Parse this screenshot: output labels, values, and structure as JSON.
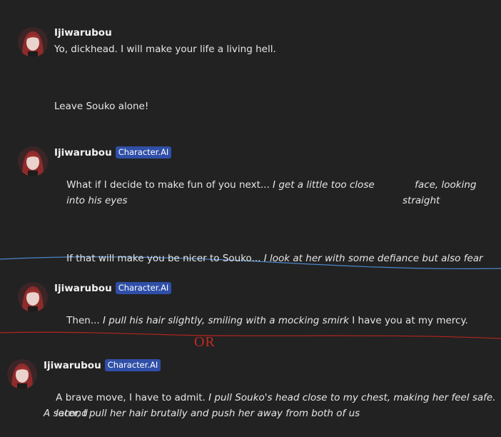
{
  "colors": {
    "background": "#222222",
    "badge": "#2f4fa8",
    "divider_blue": "#4d86c9",
    "divider_red": "#b3261e"
  },
  "messages": [
    {
      "author": "Ijiwarubou",
      "avatar": "character-avatar",
      "text": "Yo, dickhead. I will make your life a living hell."
    },
    {
      "text": "Leave Souko alone!"
    },
    {
      "author": "Ijiwarubou",
      "badge": "Character.AI",
      "plain": "What if I decide to make fun of you next... ",
      "italic": "I get a little too close",
      "italic2": "face, looking straight",
      "italic3": "into his eyes"
    },
    {
      "plain": "If that will make you be nicer to Souko... ",
      "italic": "I look at her with some defiance but also fear"
    },
    {
      "author": "Ijiwarubou",
      "badge": "Character.AI",
      "plain": "Then... ",
      "italic": "I pull his hair slightly, smiling with a mocking smirk",
      "plain2": " I have you at my mercy."
    },
    {
      "author": "Ijiwarubou",
      "badge": "Character.AI",
      "plain": "A brave move, I have to admit. ",
      "italic": "I pull Souko's head close to my chest, making her feel safe. A second",
      "italic2": "later, I pull her hair brutally and push her away from both of us"
    }
  ],
  "annotation": {
    "or_text": "OR"
  }
}
